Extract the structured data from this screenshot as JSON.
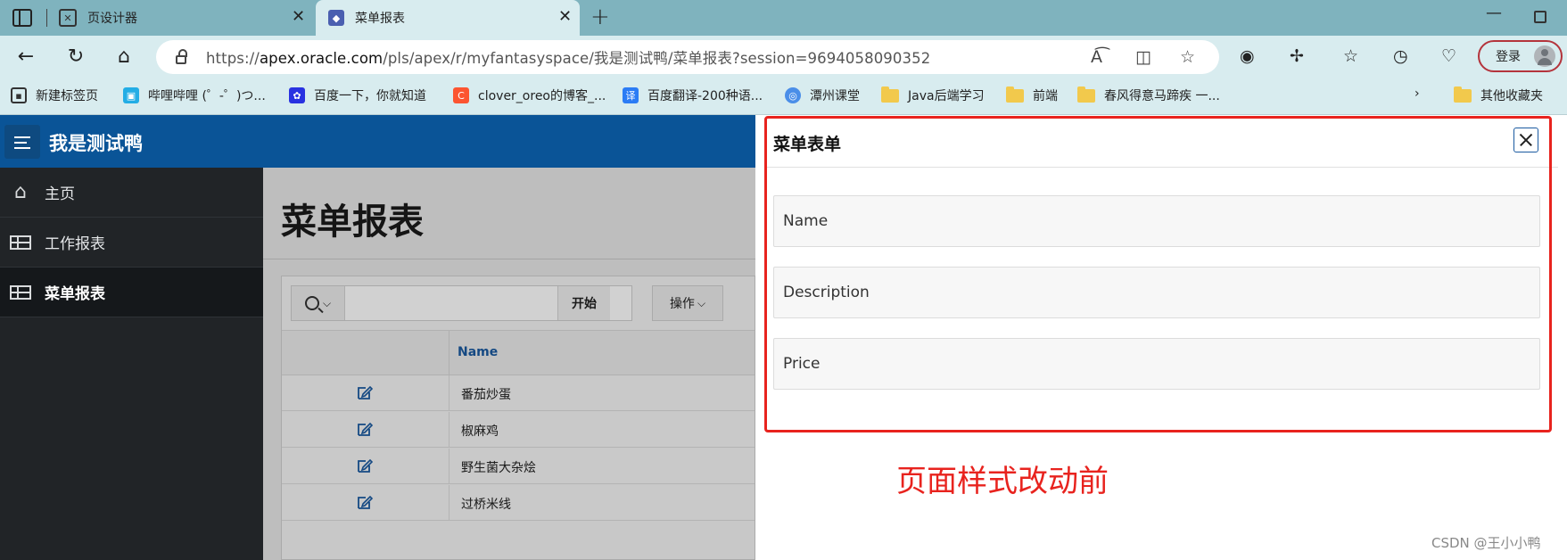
{
  "browser": {
    "tabs": [
      {
        "title": "页设计器",
        "icon": "designer-icon"
      },
      {
        "title": "菜单报表",
        "icon": "apex-app-icon"
      }
    ],
    "url_prefix": "https://",
    "url_host": "apex.oracle.com",
    "url_path": "/pls/apex/r/myfantasyspace/我是测试鸭/菜单报表?session=9694058090352",
    "profile_button": "登录",
    "bookmarks": [
      {
        "label": "新建标签页",
        "icon": "new-tab-icon"
      },
      {
        "label": "哔哩哔哩 (゜-゜)つ...",
        "icon": "bilibili-icon"
      },
      {
        "label": "百度一下，你就知道",
        "icon": "baidu-icon"
      },
      {
        "label": "clover_oreo的博客_...",
        "icon": "csdn-icon"
      },
      {
        "label": "百度翻译-200种语...",
        "icon": "baidu-translate-icon"
      },
      {
        "label": "潭州课堂",
        "icon": "tanzhou-icon"
      },
      {
        "label": "Java后端学习",
        "icon": "folder-icon"
      },
      {
        "label": "前端",
        "icon": "folder-icon"
      },
      {
        "label": "春风得意马蹄疾 一...",
        "icon": "folder-icon"
      }
    ],
    "other_bookmarks": "其他收藏夹"
  },
  "app": {
    "name": "我是测试鸭",
    "nav": [
      {
        "label": "主页",
        "icon": "home-icon",
        "active": false
      },
      {
        "label": "工作报表",
        "icon": "table-icon",
        "active": false
      },
      {
        "label": "菜单报表",
        "icon": "table-icon",
        "active": true
      }
    ],
    "page_title": "菜单报表",
    "report": {
      "go_label": "开始",
      "actions_label": "操作",
      "column_header": "Name",
      "rows": [
        "番茄炒蛋",
        "椒麻鸡",
        "野生菌大杂烩",
        "过桥米线"
      ]
    }
  },
  "dialog": {
    "title": "菜单表单",
    "fields": [
      "Name",
      "Description",
      "Price"
    ]
  },
  "annotation": "页面样式改动前",
  "watermark": "CSDN @王小小鸭",
  "colors": {
    "header_blue": "#0a5497",
    "nav_dark": "#212427",
    "annotation_red": "#e8231e",
    "link_blue": "#1a5aa0"
  }
}
